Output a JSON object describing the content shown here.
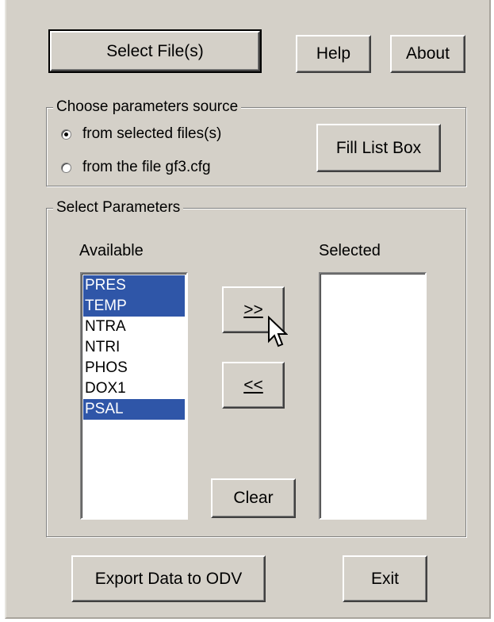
{
  "buttons": {
    "select_files": "Select File(s)",
    "help": "Help",
    "about": "About",
    "fill_list_box": "Fill List Box",
    "move_right": ">>",
    "move_left": "<<",
    "clear": "Clear",
    "export": "Export Data to ODV",
    "exit": "Exit"
  },
  "source_group": {
    "title": "Choose parameters source",
    "options": [
      {
        "label": "from selected files(s)",
        "checked": true
      },
      {
        "label": "from the file gf3.cfg",
        "checked": false
      }
    ]
  },
  "params_group": {
    "title": "Select Parameters",
    "available_label": "Available",
    "selected_label": "Selected",
    "available_items": [
      {
        "label": "PRES",
        "selected": true
      },
      {
        "label": "TEMP",
        "selected": true
      },
      {
        "label": "NTRA",
        "selected": false
      },
      {
        "label": "NTRI",
        "selected": false
      },
      {
        "label": "PHOS",
        "selected": false
      },
      {
        "label": "DOX1",
        "selected": false
      },
      {
        "label": "PSAL",
        "selected": true
      }
    ],
    "selected_items": []
  },
  "colors": {
    "face": "#d4d0c8",
    "highlight": "#2f56a8"
  }
}
